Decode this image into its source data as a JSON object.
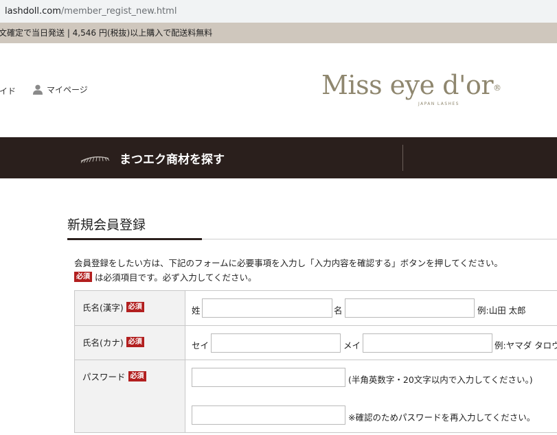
{
  "browser": {
    "host": "lashdoll.com",
    "path": "/member_regist_new.html"
  },
  "announcement": "文確定で当日発送 | 4,546 円(税抜)以上購入で配送料無料",
  "header": {
    "nav_guide": "イド",
    "nav_mypage": "マイページ",
    "logo_text": "Miss eye d'or",
    "logo_reg": "®",
    "logo_sub": "JAPAN LASHES"
  },
  "category_bar": {
    "label": "まつエク商材を探す"
  },
  "page": {
    "title": "新規会員登録",
    "intro_line1": "会員登録をしたい方は、下記のフォームに必要事項を入力し「入力内容を確認する」ボタンを押してください。",
    "required_badge": "必須",
    "intro_line2": "は必須項目です。必ず入力してください。"
  },
  "form": {
    "name_kanji": {
      "label": "氏名(漢字)",
      "sei_label": "姓",
      "mei_label": "名",
      "example": "例:山田 太郎",
      "sei_value": "",
      "mei_value": ""
    },
    "name_kana": {
      "label": "氏名(カナ)",
      "sei_label": "セイ",
      "mei_label": "メイ",
      "example": "例:ヤマダ タロウ",
      "sei_value": "",
      "mei_value": ""
    },
    "password": {
      "label": "パスワード",
      "hint": "(半角英数字・20文字以内で入力してください。)",
      "confirm_hint": "※確認のためパスワードを再入力してください。",
      "value": "",
      "confirm_value": ""
    }
  },
  "colors": {
    "dark_bar": "#2a1f1c",
    "required_badge": "#b21f1f",
    "announcement_bg": "#cfc7bd",
    "logo": "#8f876f"
  }
}
